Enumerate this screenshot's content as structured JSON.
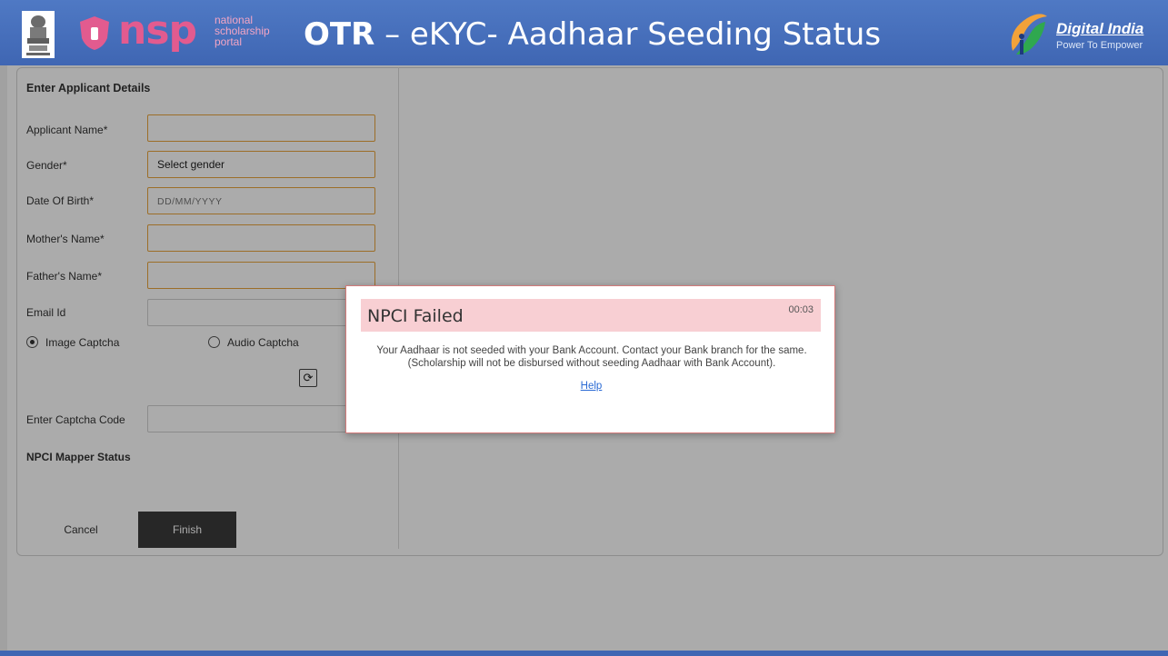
{
  "header": {
    "nsp_text": "nsp",
    "nsp_sub_line1": "national",
    "nsp_sub_line2": "scholarship",
    "nsp_sub_line3": "portal",
    "title_bold": "OTR",
    "title_rest": " – eKYC- Aadhaar Seeding Status",
    "di_title": "Digital India",
    "di_subtitle": "Power To Empower"
  },
  "form": {
    "title": "Enter Applicant Details",
    "fields": {
      "applicant_name_label": "Applicant Name*",
      "gender_label": "Gender*",
      "gender_value": "Select gender",
      "dob_label": "Date Of Birth*",
      "dob_placeholder": "DD/MM/YYYY",
      "mother_label": "Mother's Name*",
      "father_label": "Father's Name*",
      "email_label": "Email Id",
      "image_captcha": "Image Captcha",
      "audio_captcha": "Audio Captcha",
      "captcha_label": "Enter Captcha Code",
      "npci_label": "NPCI Mapper Status"
    },
    "cancel_label": "Cancel",
    "finish_label": "Finish"
  },
  "modal": {
    "title": "NPCI Failed",
    "timer": "00:03",
    "message": "Your Aadhaar is not seeded with your Bank Account. Contact your Bank branch for the same.(Scholarship will not be disbursed without seeding Aadhaar with Bank Account).",
    "help": "Help"
  },
  "colors": {
    "header_bg": "#3f66b3",
    "modal_head_bg": "#f8cfd3",
    "input_border": "#e9a43c",
    "finish_bg": "#3b3b3b"
  }
}
